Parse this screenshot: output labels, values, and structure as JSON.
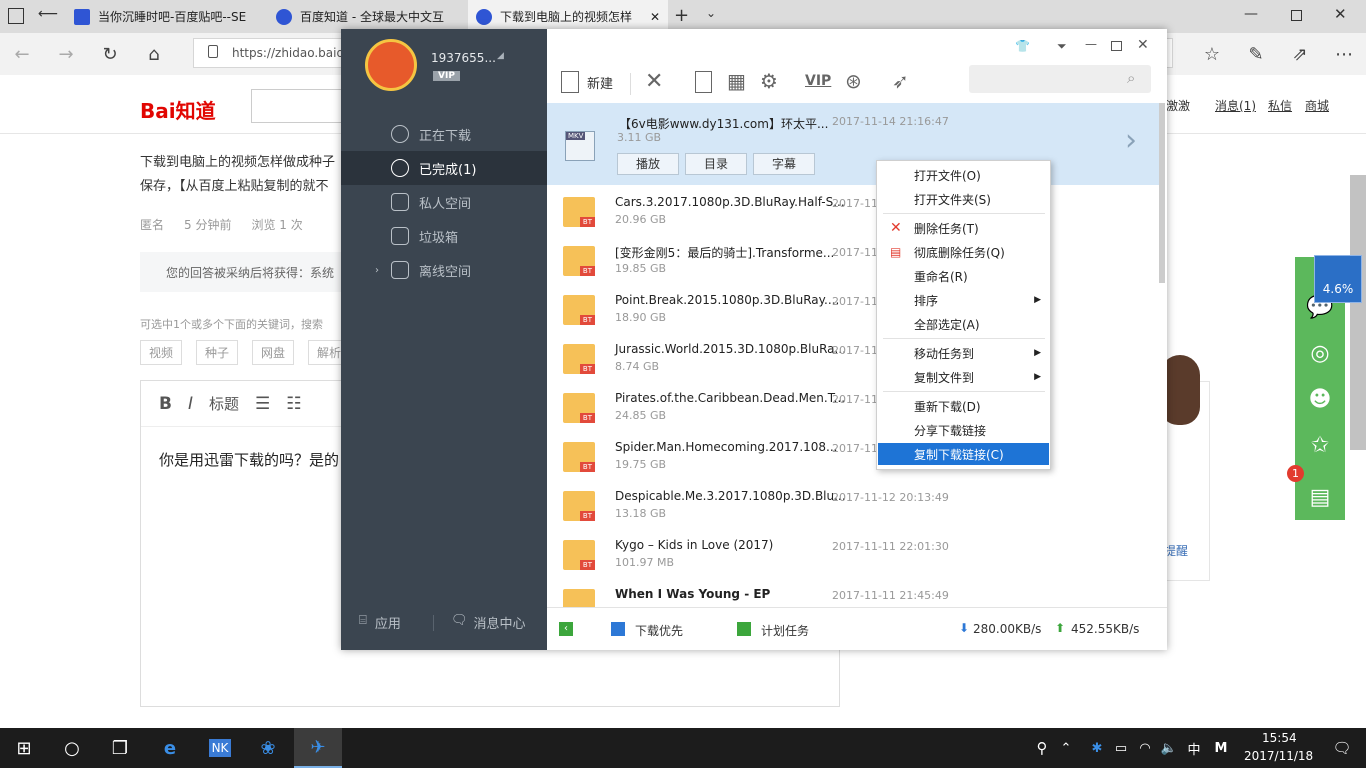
{
  "browser": {
    "tabs": [
      {
        "title": "当你沉睡时吧-百度贴吧--SE"
      },
      {
        "title": "百度知道 - 全球最大中文互"
      },
      {
        "title": "下载到电脑上的视频怎样"
      }
    ],
    "address": "https://zhidao.baidu"
  },
  "page": {
    "logo": "Bai知道",
    "header_links": [
      "消息(1)",
      "私信",
      "商城"
    ],
    "activation": "激激",
    "question_line1": "下载到电脑上的视频怎样做成种子",
    "question_line2": "保存，【从百度上粘贴复制的就不",
    "meta": [
      "匿名",
      "5 分钟前",
      "浏览 1 次"
    ],
    "reward_note": "您的回答被采纳后将获得：系统",
    "keywords_hint": "可选中1个或多个下面的关键词，搜索",
    "tags": [
      "视频",
      "种子",
      "网盘",
      "解析"
    ],
    "editor_tools": [
      "B",
      "I",
      "标题"
    ],
    "answer_text": "你是用迅雷下载的吗？是的",
    "reminder": "提醒",
    "percent_badge": "4.6%",
    "notify_count": "1"
  },
  "xunlei": {
    "user": "1937655...",
    "vip": "VIP",
    "sidebar": [
      {
        "label": "正在下载"
      },
      {
        "label": "已完成(1)"
      },
      {
        "label": "私人空间"
      },
      {
        "label": "垃圾箱"
      },
      {
        "label": "离线空间"
      }
    ],
    "bottom_left": [
      "应用",
      "消息中心"
    ],
    "toolbar": {
      "new_label": "新建",
      "vip": "VIP"
    },
    "top_item": {
      "name": "【6v电影www.dy131.com】环太平...",
      "size": "3.11 GB",
      "date": "2017-11-14 21:16:47",
      "buttons": [
        "播放",
        "目录",
        "字幕"
      ],
      "badge": "MKV"
    },
    "items": [
      {
        "name": "Cars.3.2017.1080p.3D.BluRay.Half-S...",
        "size": "20.96 GB",
        "date": "2017-11"
      },
      {
        "name": "[变形金刚5：最后的骑士].Transforme...",
        "size": "19.85 GB",
        "date": "2017-11"
      },
      {
        "name": "Point.Break.2015.1080p.3D.BluRay....",
        "size": "18.90 GB",
        "date": "2017-11"
      },
      {
        "name": "Jurassic.World.2015.3D.1080p.BluRa...",
        "size": "8.74 GB",
        "date": "2017-11"
      },
      {
        "name": "Pirates.of.the.Caribbean.Dead.Men.T...",
        "size": "24.85 GB",
        "date": "2017-11"
      },
      {
        "name": "Spider.Man.Homecoming.2017.108...",
        "size": "19.75 GB",
        "date": "2017-11"
      },
      {
        "name": "Despicable.Me.3.2017.1080p.3D.Blu...",
        "size": "13.18 GB",
        "date": "2017-11-12 20:13:49"
      },
      {
        "name": "Kygo – Kids in Love (2017)",
        "size": "101.97 MB",
        "date": "2017-11-11 22:01:30"
      },
      {
        "name": "When I Was Young - EP",
        "size": "",
        "date": "2017-11-11 21:45:49"
      }
    ],
    "statusbar": {
      "priority": "下载优先",
      "plan": "计划任务",
      "down": "280.00KB/s",
      "up": "452.55KB/s"
    },
    "context_menu": [
      "打开文件(O)",
      "打开文件夹(S)",
      "删除任务(T)",
      "彻底删除任务(Q)",
      "重命名(R)",
      "排序",
      "全部选定(A)",
      "移动任务到",
      "复制文件到",
      "重新下载(D)",
      "分享下载链接",
      "复制下载链接(C)"
    ]
  },
  "taskbar": {
    "time": "15:54",
    "date": "2017/11/18",
    "ime": "中",
    "ime2": "M"
  }
}
